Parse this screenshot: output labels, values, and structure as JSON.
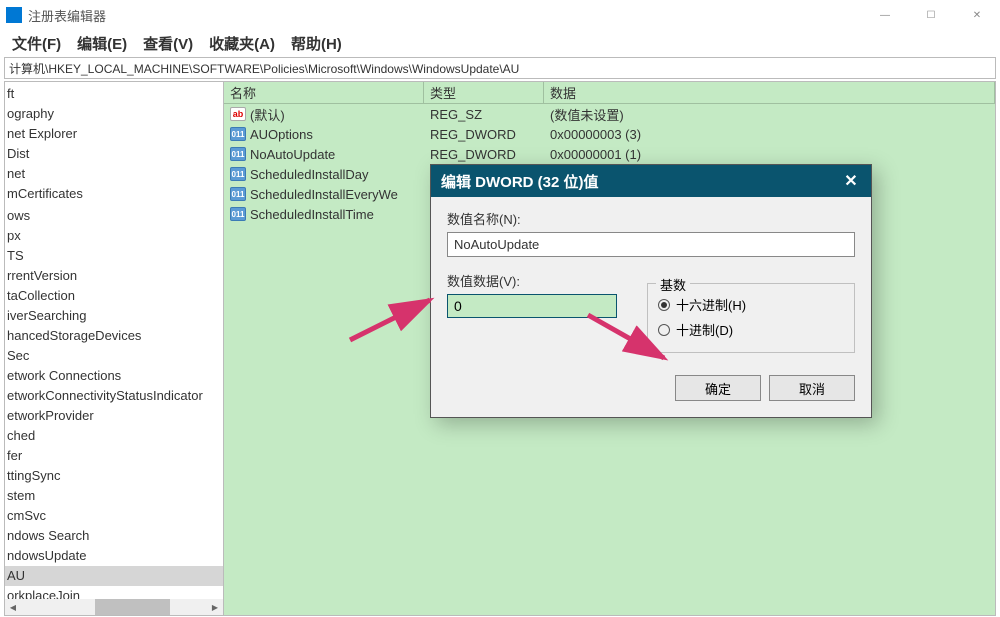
{
  "window": {
    "title": "注册表编辑器",
    "min": "—",
    "max": "☐",
    "close": "✕"
  },
  "menu": {
    "file": "文件(F)",
    "edit": "编辑(E)",
    "view": "查看(V)",
    "fav": "收藏夹(A)",
    "help": "帮助(H)"
  },
  "address": "计算机\\HKEY_LOCAL_MACHINE\\SOFTWARE\\Policies\\Microsoft\\Windows\\WindowsUpdate\\AU",
  "tree": [
    "ft",
    "ography",
    "net Explorer",
    "Dist",
    "net",
    "mCertificates",
    "",
    "ows",
    "px",
    "TS",
    "rrentVersion",
    "taCollection",
    "iverSearching",
    "hancedStorageDevices",
    "Sec",
    "etwork Connections",
    "etworkConnectivityStatusIndicator",
    "etworkProvider",
    "ched",
    "fer",
    "ttingSync",
    "stem",
    "cmSvc",
    "ndows Search",
    "ndowsUpdate",
    "AU",
    "orkplaceJoin"
  ],
  "tree_selected_index": 25,
  "columns": {
    "name": "名称",
    "type": "类型",
    "data": "数据"
  },
  "rows": [
    {
      "icon": "ab",
      "name": "(默认)",
      "type": "REG_SZ",
      "data": "(数值未设置)"
    },
    {
      "icon": "01",
      "name": "AUOptions",
      "type": "REG_DWORD",
      "data": "0x00000003 (3)"
    },
    {
      "icon": "01",
      "name": "NoAutoUpdate",
      "type": "REG_DWORD",
      "data": "0x00000001 (1)"
    },
    {
      "icon": "01",
      "name": "ScheduledInstallDay",
      "type": "",
      "data": ""
    },
    {
      "icon": "01",
      "name": "ScheduledInstallEveryWe",
      "type": "",
      "data": ""
    },
    {
      "icon": "01",
      "name": "ScheduledInstallTime",
      "type": "",
      "data": ""
    }
  ],
  "dialog": {
    "title": "编辑 DWORD (32 位)值",
    "name_label": "数值名称(N):",
    "name_value": "NoAutoUpdate",
    "data_label": "数值数据(V):",
    "data_value": "0",
    "base_label": "基数",
    "radio_hex": "十六进制(H)",
    "radio_dec": "十进制(D)",
    "ok": "确定",
    "cancel": "取消"
  }
}
